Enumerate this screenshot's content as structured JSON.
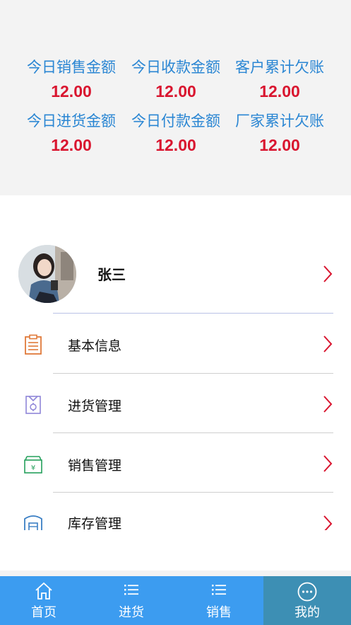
{
  "stats": [
    {
      "label": "今日销售金额",
      "value": "12.00"
    },
    {
      "label": "今日收款金额",
      "value": "12.00"
    },
    {
      "label": "客户累计欠账",
      "value": "12.00"
    },
    {
      "label": "今日进货金额",
      "value": "12.00"
    },
    {
      "label": "今日付款金额",
      "value": "12.00"
    },
    {
      "label": "厂家累计欠账",
      "value": "12.00"
    }
  ],
  "profile": {
    "name": "张三"
  },
  "menu": [
    {
      "label": "基本信息",
      "icon": "document-list-icon",
      "color": "#e07a3a"
    },
    {
      "label": "进货管理",
      "icon": "purchase-box-icon",
      "color": "#8f86d8"
    },
    {
      "label": "销售管理",
      "icon": "cash-register-icon",
      "color": "#25a05c"
    },
    {
      "label": "库存管理",
      "icon": "warehouse-icon",
      "color": "#3b7fc4"
    }
  ],
  "tabs": [
    {
      "label": "首页",
      "icon": "home-icon"
    },
    {
      "label": "进货",
      "icon": "list-icon"
    },
    {
      "label": "销售",
      "icon": "list-icon"
    },
    {
      "label": "我的",
      "icon": "more-icon",
      "active": true
    }
  ],
  "colors": {
    "accent_blue": "#2a86d3",
    "value_red": "#d9152f",
    "tab_bar": "#3c9cf0",
    "tab_active": "#3d8fb4",
    "chevron": "#d9152f"
  }
}
